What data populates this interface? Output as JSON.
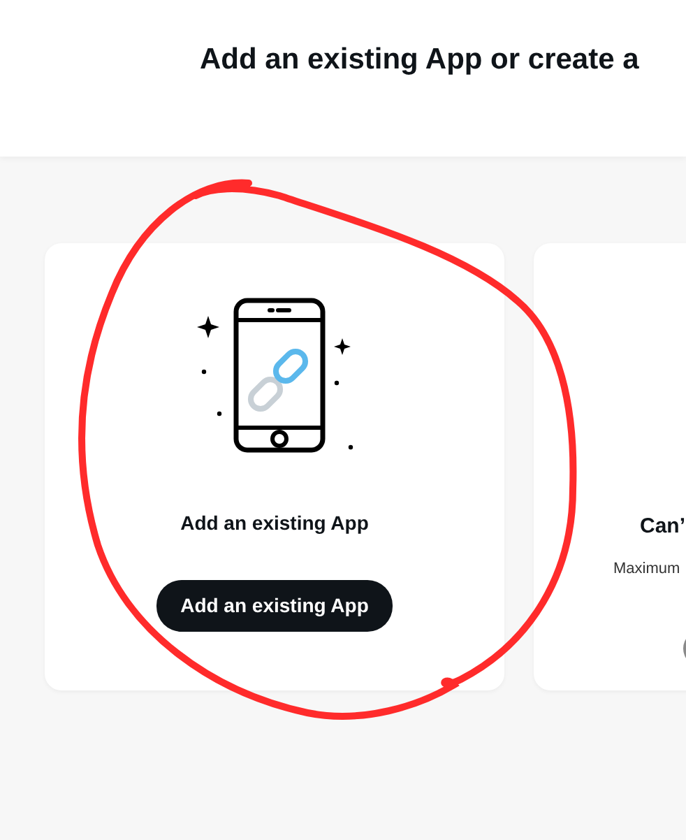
{
  "header": {
    "title": "Add an existing App or create a"
  },
  "cards": [
    {
      "kind": "action",
      "title": "Add an existing App",
      "button": "Add an existing App"
    },
    {
      "kind": "limit",
      "title": "Can’",
      "text": "Maximum"
    }
  ]
}
